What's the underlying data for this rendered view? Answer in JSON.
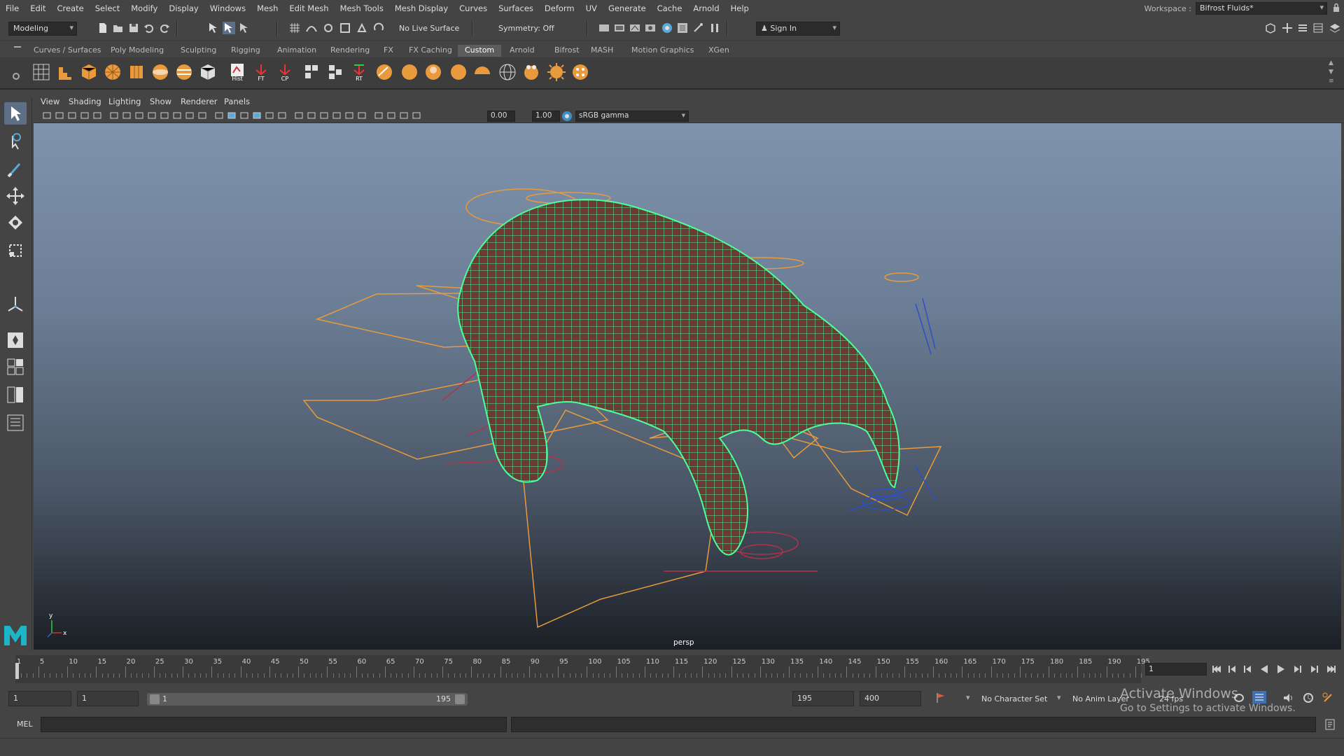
{
  "menubar": {
    "items": [
      "File",
      "Edit",
      "Create",
      "Select",
      "Modify",
      "Display",
      "Windows",
      "Mesh",
      "Edit Mesh",
      "Mesh Tools",
      "Mesh Display",
      "Curves",
      "Surfaces",
      "Deform",
      "UV",
      "Generate",
      "Cache",
      "Arnold",
      "Help"
    ],
    "workspace_label": "Workspace :",
    "workspace_value": "Bifrost Fluids*"
  },
  "statusline": {
    "mode": "Modeling",
    "live_surface": "No Live Surface",
    "symmetry": "Symmetry: Off",
    "sign_in": "Sign In"
  },
  "shelf": {
    "tabs": [
      "Curves / Surfaces",
      "Poly Modeling",
      "Sculpting",
      "Rigging",
      "Animation",
      "Rendering",
      "FX",
      "FX Caching",
      "Custom",
      "Arnold",
      "Bifrost",
      "MASH",
      "Motion Graphics",
      "XGen"
    ],
    "active_tab": "Custom",
    "icon_labels": {
      "hist": "Hist",
      "ft": "FT",
      "cp": "CP",
      "rt": "RT"
    }
  },
  "panel": {
    "menu": [
      "View",
      "Shading",
      "Lighting",
      "Show",
      "Renderer",
      "Panels"
    ],
    "exposure": "0.00",
    "gamma": "1.00",
    "color_space": "sRGB gamma",
    "camera_name": "persp",
    "axis_y": "y",
    "axis_x": "x"
  },
  "timeline": {
    "tick_labels": [
      "1",
      "5",
      "10",
      "15",
      "20",
      "25",
      "30",
      "35",
      "40",
      "45",
      "50",
      "55",
      "60",
      "65",
      "70",
      "75",
      "80",
      "85",
      "90",
      "95",
      "100",
      "105",
      "110",
      "115",
      "120",
      "125",
      "130",
      "135",
      "140",
      "145",
      "150",
      "155",
      "160",
      "165",
      "170",
      "175",
      "180",
      "185",
      "190",
      "195"
    ],
    "current_frame": "1"
  },
  "range": {
    "start_time": "1",
    "playback_start": "1",
    "slider_start": "1",
    "slider_end": "195",
    "playback_end": "195",
    "end_time": "400",
    "character_set": "No Character Set",
    "anim_layer": "No Anim Layer",
    "fps": "24 fps"
  },
  "cmdline": {
    "label": "MEL"
  },
  "watermark": {
    "title": "Activate Windows",
    "subtitle": "Go to Settings to activate Windows."
  },
  "colors": {
    "ui_bg": "#444444",
    "accent_orange": "#e89a3c",
    "wireframe_green": "#4dff9a",
    "active_tab": "#5d5d5d",
    "viewport_top": "#7f93ad",
    "viewport_bottom": "#1b1f25"
  }
}
